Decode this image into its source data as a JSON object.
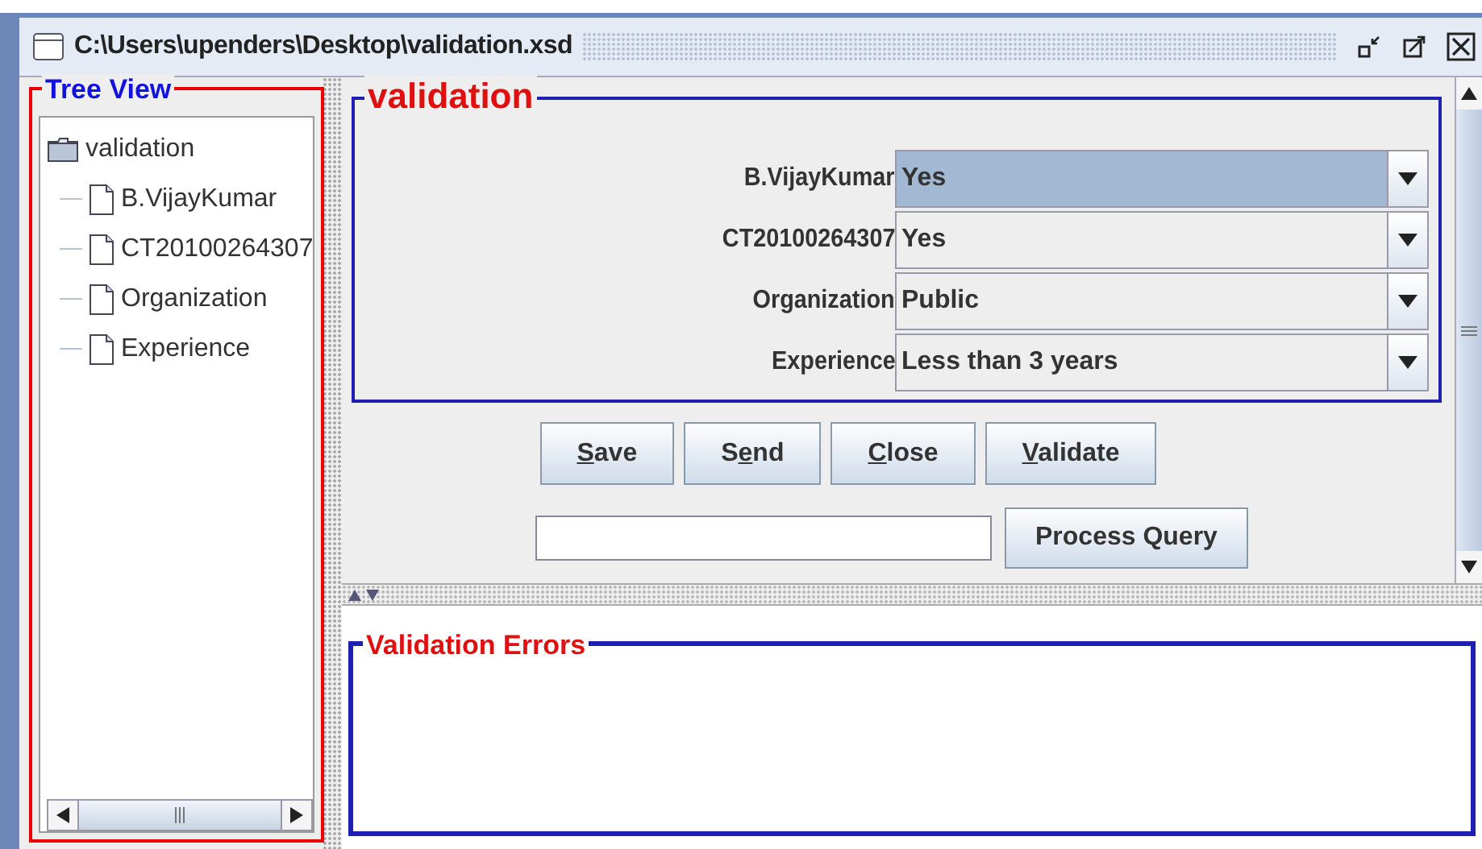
{
  "window": {
    "title": "C:\\Users\\upenders\\Desktop\\validation.xsd"
  },
  "tree_view": {
    "title": "Tree View",
    "root": {
      "label": "validation",
      "children": [
        {
          "label": "B.VijayKumar"
        },
        {
          "label": "CT20100264307"
        },
        {
          "label": "Organization"
        },
        {
          "label": "Experience"
        }
      ]
    }
  },
  "form": {
    "title": "validation",
    "fields": [
      {
        "label": "B.VijayKumar",
        "value": "Yes",
        "focused": true
      },
      {
        "label": "CT20100264307",
        "value": "Yes",
        "focused": false
      },
      {
        "label": "Organization",
        "value": "Public",
        "focused": false
      },
      {
        "label": "Experience",
        "value": "Less than 3 years",
        "focused": false
      }
    ],
    "buttons": [
      {
        "mnemonic": "S",
        "end": "ave"
      },
      {
        "start": "S",
        "mnemonic": "e",
        "end": "nd"
      },
      {
        "mnemonic": "C",
        "end": "lose"
      },
      {
        "mnemonic": "V",
        "end": "alidate"
      }
    ],
    "query_button": "Process Query"
  },
  "errors": {
    "title": "Validation Errors"
  }
}
